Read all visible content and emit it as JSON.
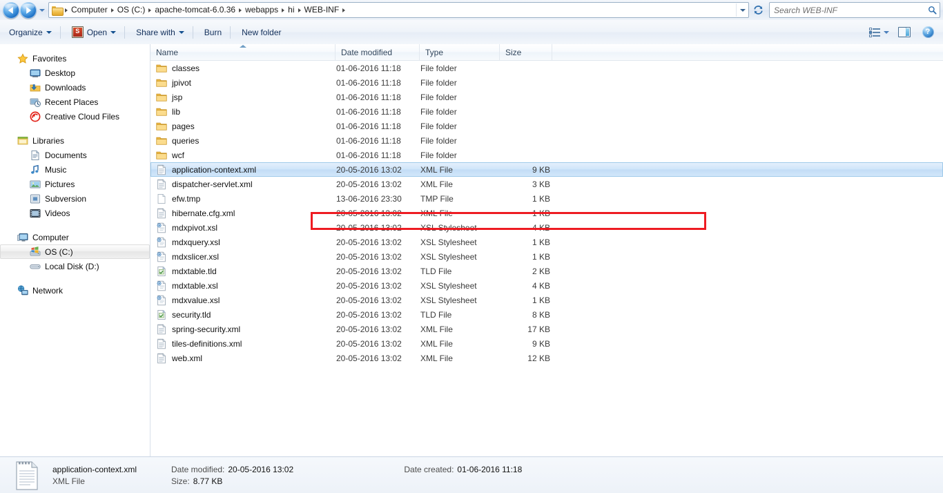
{
  "addressbar": {
    "back_tooltip": "Back",
    "forward_tooltip": "Forward",
    "recent_tooltip": "Recent pages",
    "breadcrumbs": [
      "Computer",
      "OS (C:)",
      "apache-tomcat-6.0.36",
      "webapps",
      "hi",
      "WEB-INF"
    ],
    "refresh_tooltip": "Refresh",
    "search": {
      "value": "",
      "placeholder": "Search WEB-INF"
    }
  },
  "toolbar": {
    "organize_label": "Organize",
    "open_label": "Open",
    "share_label": "Share with",
    "burn_label": "Burn",
    "newfolder_label": "New folder",
    "change_view_tooltip": "Change your view",
    "preview_tooltip": "Show the preview pane",
    "help_label": "?",
    "help_tooltip": "Get help"
  },
  "navpane": {
    "groups": [
      {
        "header": {
          "label": "Favorites",
          "icon": "star-icon"
        },
        "items": [
          {
            "label": "Desktop",
            "icon": "desktop-icon"
          },
          {
            "label": "Downloads",
            "icon": "downloads-icon"
          },
          {
            "label": "Recent Places",
            "icon": "recent-places-icon"
          },
          {
            "label": "Creative Cloud Files",
            "icon": "creative-cloud-icon"
          }
        ]
      },
      {
        "header": {
          "label": "Libraries",
          "icon": "libraries-icon"
        },
        "items": [
          {
            "label": "Documents",
            "icon": "documents-icon"
          },
          {
            "label": "Music",
            "icon": "music-icon"
          },
          {
            "label": "Pictures",
            "icon": "pictures-icon"
          },
          {
            "label": "Subversion",
            "icon": "subversion-icon"
          },
          {
            "label": "Videos",
            "icon": "videos-icon"
          }
        ]
      },
      {
        "header": {
          "label": "Computer",
          "icon": "computer-icon"
        },
        "items": [
          {
            "label": "OS (C:)",
            "icon": "hdd-windows-icon",
            "selected": true
          },
          {
            "label": "Local Disk (D:)",
            "icon": "hdd-icon"
          }
        ]
      },
      {
        "header": {
          "label": "Network",
          "icon": "network-icon"
        },
        "items": []
      }
    ]
  },
  "filelist": {
    "columns": [
      {
        "label": "Name",
        "sorted": "asc"
      },
      {
        "label": "Date modified"
      },
      {
        "label": "Type"
      },
      {
        "label": "Size"
      }
    ],
    "rows": [
      {
        "name": "classes",
        "date": "01-06-2016 11:18",
        "type": "File folder",
        "size": "",
        "icon": "folder-icon"
      },
      {
        "name": "jpivot",
        "date": "01-06-2016 11:18",
        "type": "File folder",
        "size": "",
        "icon": "folder-icon"
      },
      {
        "name": "jsp",
        "date": "01-06-2016 11:18",
        "type": "File folder",
        "size": "",
        "icon": "folder-icon"
      },
      {
        "name": "lib",
        "date": "01-06-2016 11:18",
        "type": "File folder",
        "size": "",
        "icon": "folder-icon"
      },
      {
        "name": "pages",
        "date": "01-06-2016 11:18",
        "type": "File folder",
        "size": "",
        "icon": "folder-icon"
      },
      {
        "name": "queries",
        "date": "01-06-2016 11:18",
        "type": "File folder",
        "size": "",
        "icon": "folder-icon"
      },
      {
        "name": "wcf",
        "date": "01-06-2016 11:18",
        "type": "File folder",
        "size": "",
        "icon": "folder-icon"
      },
      {
        "name": "application-context.xml",
        "date": "20-05-2016 13:02",
        "type": "XML File",
        "size": "9 KB",
        "icon": "xml-file-icon",
        "selected": true,
        "highlighted": true
      },
      {
        "name": "dispatcher-servlet.xml",
        "date": "20-05-2016 13:02",
        "type": "XML File",
        "size": "3 KB",
        "icon": "xml-file-icon"
      },
      {
        "name": "efw.tmp",
        "date": "13-06-2016 23:30",
        "type": "TMP File",
        "size": "1 KB",
        "icon": "blank-file-icon"
      },
      {
        "name": "hibernate.cfg.xml",
        "date": "20-05-2016 13:02",
        "type": "XML File",
        "size": "1 KB",
        "icon": "xml-file-icon"
      },
      {
        "name": "mdxpivot.xsl",
        "date": "20-05-2016 13:02",
        "type": "XSL Stylesheet",
        "size": "4 KB",
        "icon": "xsl-file-icon"
      },
      {
        "name": "mdxquery.xsl",
        "date": "20-05-2016 13:02",
        "type": "XSL Stylesheet",
        "size": "1 KB",
        "icon": "xsl-file-icon"
      },
      {
        "name": "mdxslicer.xsl",
        "date": "20-05-2016 13:02",
        "type": "XSL Stylesheet",
        "size": "1 KB",
        "icon": "xsl-file-icon"
      },
      {
        "name": "mdxtable.tld",
        "date": "20-05-2016 13:02",
        "type": "TLD File",
        "size": "2 KB",
        "icon": "tld-file-icon"
      },
      {
        "name": "mdxtable.xsl",
        "date": "20-05-2016 13:02",
        "type": "XSL Stylesheet",
        "size": "4 KB",
        "icon": "xsl-file-icon"
      },
      {
        "name": "mdxvalue.xsl",
        "date": "20-05-2016 13:02",
        "type": "XSL Stylesheet",
        "size": "1 KB",
        "icon": "xsl-file-icon"
      },
      {
        "name": "security.tld",
        "date": "20-05-2016 13:02",
        "type": "TLD File",
        "size": "8 KB",
        "icon": "tld-file-icon"
      },
      {
        "name": "spring-security.xml",
        "date": "20-05-2016 13:02",
        "type": "XML File",
        "size": "17 KB",
        "icon": "xml-file-icon"
      },
      {
        "name": "tiles-definitions.xml",
        "date": "20-05-2016 13:02",
        "type": "XML File",
        "size": "9 KB",
        "icon": "xml-file-icon"
      },
      {
        "name": "web.xml",
        "date": "20-05-2016 13:02",
        "type": "XML File",
        "size": "12 KB",
        "icon": "xml-file-icon"
      }
    ]
  },
  "details_pane": {
    "file_name": "application-context.xml",
    "file_type": "XML File",
    "date_modified_label": "Date modified:",
    "date_modified_value": "20-05-2016 13:02",
    "size_label": "Size:",
    "size_value": "8.77 KB",
    "date_created_label": "Date created:",
    "date_created_value": "01-06-2016 11:18"
  },
  "colors": {
    "annotation_red": "#ee1b22",
    "selection_blue": "#cfe5f9",
    "chrome_blue": "#e7eef7"
  }
}
